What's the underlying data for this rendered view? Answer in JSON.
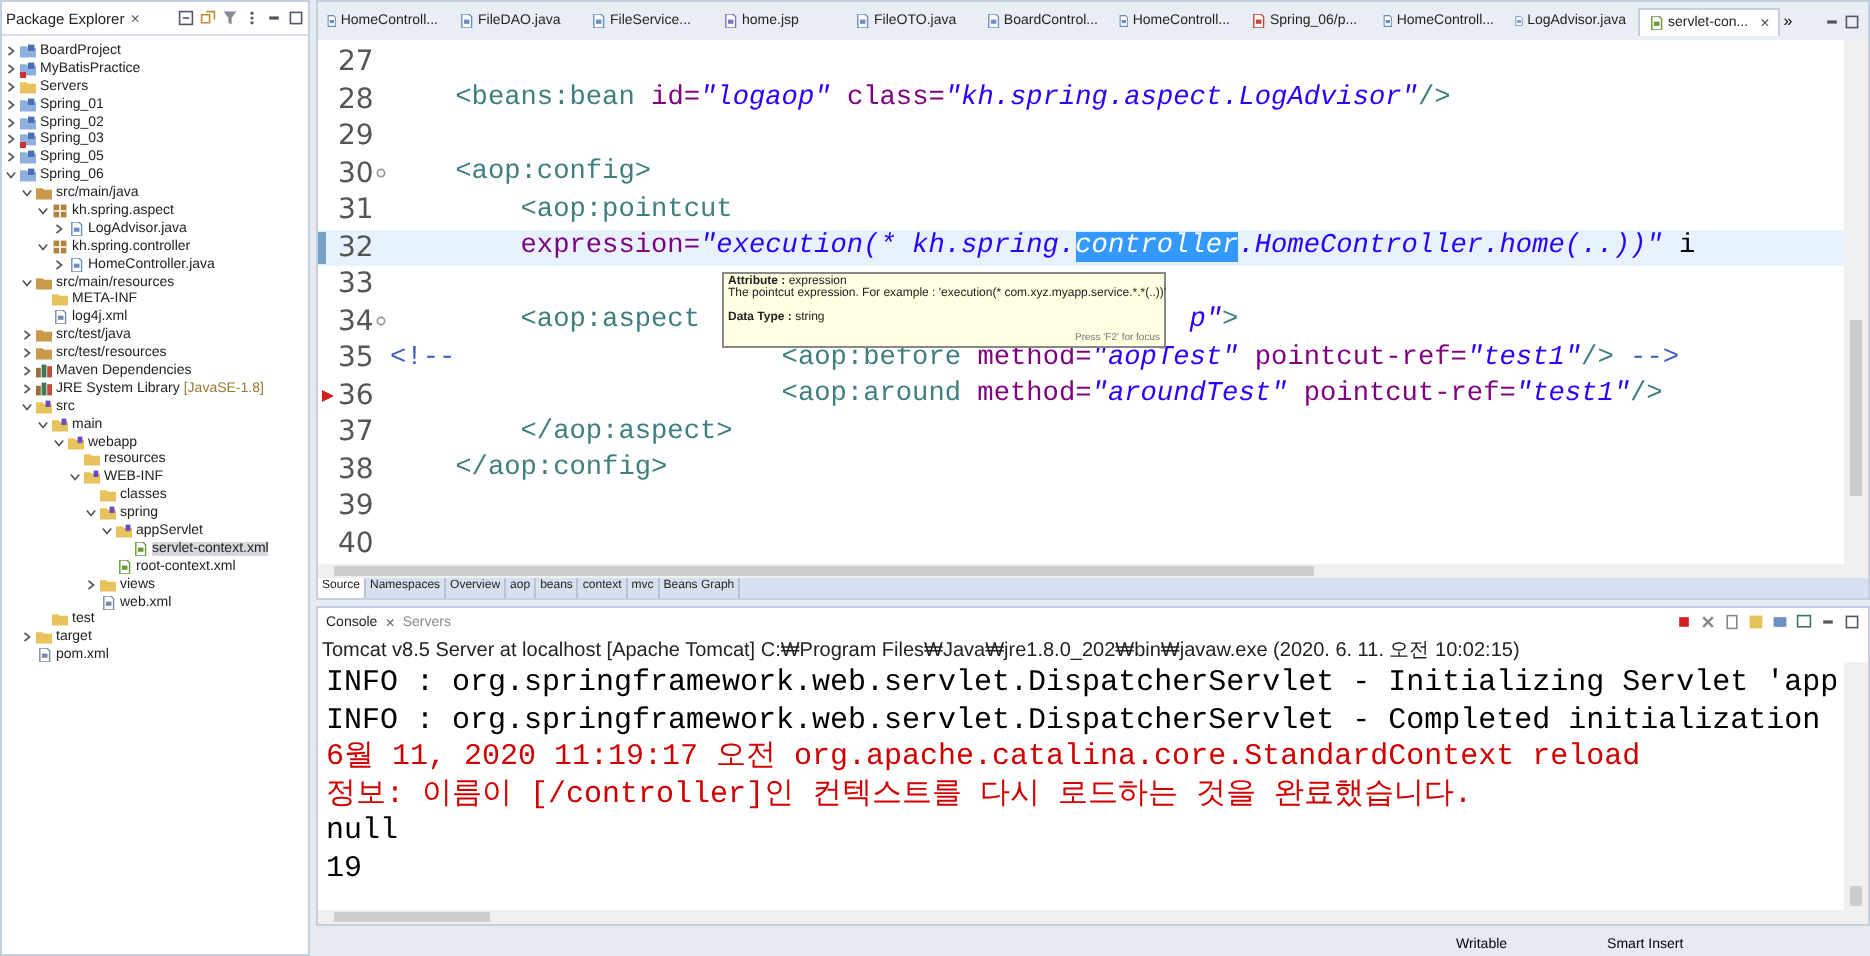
{
  "explorer": {
    "title": "Package Explorer",
    "close": "×",
    "tree": [
      {
        "label": "BoardProject",
        "kind": "project",
        "error": false,
        "expanded": false,
        "selected": false
      },
      {
        "label": "MyBatisPractice",
        "kind": "project",
        "error": true,
        "expanded": false,
        "selected": false
      },
      {
        "label": "Servers",
        "kind": "folder",
        "error": false,
        "expanded": false,
        "selected": false
      },
      {
        "label": "Spring_01",
        "kind": "project",
        "error": false,
        "expanded": false,
        "selected": false
      },
      {
        "label": "Spring_02",
        "kind": "project",
        "error": false,
        "expanded": false,
        "selected": false
      },
      {
        "label": "Spring_03",
        "kind": "project",
        "error": true,
        "expanded": false,
        "selected": false
      },
      {
        "label": "Spring_05",
        "kind": "project",
        "error": false,
        "expanded": false,
        "selected": false
      },
      {
        "label": "Spring_06",
        "kind": "project",
        "error": false,
        "expanded": true,
        "selected": false,
        "children": [
          {
            "label": "src/main/java",
            "kind": "source",
            "error": false,
            "expanded": true,
            "selected": false,
            "children": [
              {
                "label": "kh.spring.aspect",
                "kind": "package",
                "error": false,
                "expanded": true,
                "selected": false,
                "children": [
                  {
                    "label": "LogAdvisor.java",
                    "kind": "java",
                    "error": false,
                    "expanded": false,
                    "selected": false
                  }
                ]
              },
              {
                "label": "kh.spring.controller",
                "kind": "package",
                "error": false,
                "expanded": true,
                "selected": false,
                "children": [
                  {
                    "label": "HomeController.java",
                    "kind": "java",
                    "error": false,
                    "expanded": false,
                    "selected": false
                  }
                ]
              }
            ]
          },
          {
            "label": "src/main/resources",
            "kind": "source",
            "error": false,
            "expanded": true,
            "selected": false,
            "children": [
              {
                "label": "META-INF",
                "kind": "folder",
                "error": false,
                "selected": false
              },
              {
                "label": "log4j.xml",
                "kind": "xml",
                "error": false,
                "selected": false
              }
            ]
          },
          {
            "label": "src/test/java",
            "kind": "source",
            "error": false,
            "expanded": false,
            "selected": false
          },
          {
            "label": "src/test/resources",
            "kind": "source",
            "error": false,
            "expanded": false,
            "selected": false
          },
          {
            "label": "Maven Dependencies",
            "kind": "library",
            "error": false,
            "expanded": false,
            "selected": false
          },
          {
            "label": "JRE System Library",
            "decoration": "[JavaSE-1.8]",
            "kind": "library",
            "error": false,
            "expanded": false,
            "selected": false
          },
          {
            "label": "src",
            "kind": "spring",
            "error": false,
            "expanded": true,
            "selected": false,
            "children": [
              {
                "label": "main",
                "kind": "spring",
                "error": false,
                "expanded": true,
                "selected": false,
                "children": [
                  {
                    "label": "webapp",
                    "kind": "spring",
                    "error": false,
                    "expanded": true,
                    "selected": false,
                    "children": [
                      {
                        "label": "resources",
                        "kind": "folder",
                        "error": false,
                        "selected": false
                      },
                      {
                        "label": "WEB-INF",
                        "kind": "spring",
                        "error": false,
                        "expanded": true,
                        "selected": false,
                        "children": [
                          {
                            "label": "classes",
                            "kind": "folder",
                            "error": false,
                            "selected": false
                          },
                          {
                            "label": "spring",
                            "kind": "spring",
                            "error": false,
                            "expanded": true,
                            "selected": false,
                            "children": [
                              {
                                "label": "appServlet",
                                "kind": "spring",
                                "error": false,
                                "expanded": true,
                                "selected": false,
                                "children": [
                                  {
                                    "label": "servlet-context.xml",
                                    "kind": "beans",
                                    "error": false,
                                    "selected": true
                                  }
                                ]
                              },
                              {
                                "label": "root-context.xml",
                                "kind": "beans",
                                "error": false,
                                "selected": false
                              }
                            ]
                          },
                          {
                            "label": "views",
                            "kind": "folder",
                            "error": false,
                            "expanded": false,
                            "selected": false
                          },
                          {
                            "label": "web.xml",
                            "kind": "xml",
                            "error": false,
                            "selected": false
                          }
                        ]
                      }
                    ]
                  }
                ]
              },
              {
                "label": "test",
                "kind": "folder",
                "error": false,
                "selected": false
              }
            ]
          },
          {
            "label": "target",
            "kind": "folder",
            "error": false,
            "expanded": false,
            "selected": false
          },
          {
            "label": "pom.xml",
            "kind": "xml",
            "error": false,
            "selected": false
          }
        ]
      }
    ]
  },
  "editor": {
    "tabs": [
      {
        "label": "HomeControll...",
        "kind": "java",
        "selected": false
      },
      {
        "label": "FileDAO.java",
        "kind": "java",
        "selected": false
      },
      {
        "label": "FileService...",
        "kind": "java",
        "selected": false
      },
      {
        "label": "home.jsp",
        "kind": "jsp",
        "selected": false
      },
      {
        "label": "FileOTO.java",
        "kind": "java",
        "selected": false
      },
      {
        "label": "BoardControl...",
        "kind": "java",
        "selected": false
      },
      {
        "label": "HomeControll...",
        "kind": "java",
        "selected": false
      },
      {
        "label": "Spring_06/p...",
        "kind": "maven",
        "selected": false
      },
      {
        "label": "HomeControll...",
        "kind": "java",
        "selected": false
      },
      {
        "label": "LogAdvisor.java",
        "kind": "java",
        "selected": false
      },
      {
        "label": "servlet-con...",
        "kind": "beans",
        "selected": true
      }
    ],
    "tab_close": "×",
    "overflow": "»",
    "lines": [
      {
        "number": "27",
        "current": false,
        "foldable": false,
        "error_marker": false
      },
      {
        "number": "28",
        "current": false,
        "foldable": false,
        "error_marker": false,
        "tokens": [
          {
            "kind": "tag",
            "text": "    <beans:bean"
          },
          {
            "kind": "attr",
            "text": " id="
          },
          {
            "kind": "string",
            "text": "\"logaop\""
          },
          {
            "kind": "attr",
            "text": " class="
          },
          {
            "kind": "string",
            "text": "\"kh.spring.aspect.LogAdvisor\""
          },
          {
            "kind": "tag",
            "text": "/>"
          }
        ]
      },
      {
        "number": "29",
        "current": false,
        "foldable": false,
        "error_marker": false
      },
      {
        "number": "30",
        "current": false,
        "foldable": true,
        "error_marker": false,
        "tokens": [
          {
            "kind": "tag",
            "text": "    <aop:config>"
          }
        ]
      },
      {
        "number": "31",
        "current": false,
        "foldable": false,
        "error_marker": false,
        "tokens": [
          {
            "kind": "tag",
            "text": "        <aop:pointcut"
          }
        ]
      },
      {
        "number": "32",
        "current": true,
        "foldable": false,
        "error_marker": false,
        "tokens": [
          {
            "kind": "attr",
            "text": "        expression="
          },
          {
            "kind": "string",
            "text": "\"execution(* kh.spring."
          },
          {
            "kind": "selected",
            "text": "controller"
          },
          {
            "kind": "string",
            "text": ".HomeController.home(..))\""
          },
          {
            "kind": "plain",
            "text": " i"
          }
        ]
      },
      {
        "number": "33",
        "current": false,
        "foldable": false,
        "error_marker": false
      },
      {
        "number": "34",
        "current": false,
        "foldable": true,
        "error_marker": false,
        "tokens": [
          {
            "kind": "tag",
            "text": "        <aop:aspect"
          },
          {
            "kind": "string",
            "text": "p\"",
            "after_covered_gap": true
          },
          {
            "kind": "tag",
            "text": ">"
          }
        ]
      },
      {
        "number": "35",
        "current": false,
        "foldable": false,
        "error_marker": false,
        "tokens": [
          {
            "kind": "comment",
            "text": "<!--"
          },
          {
            "kind": "tag",
            "text": "                    <aop:before"
          },
          {
            "kind": "attr",
            "text": " method="
          },
          {
            "kind": "string",
            "text": "\"aopTest\""
          },
          {
            "kind": "attr",
            "text": " pointcut-ref="
          },
          {
            "kind": "string",
            "text": "\"test1\""
          },
          {
            "kind": "tag",
            "text": "/>"
          },
          {
            "kind": "comment",
            "text": " -->"
          }
        ]
      },
      {
        "number": "36",
        "current": false,
        "foldable": false,
        "error_marker": true,
        "tokens": [
          {
            "kind": "tag",
            "text": "                        <aop:around"
          },
          {
            "kind": "attr",
            "text": " method="
          },
          {
            "kind": "string",
            "text": "\"aroundTest\""
          },
          {
            "kind": "attr",
            "text": " pointcut-ref="
          },
          {
            "kind": "string",
            "text": "\"test1\""
          },
          {
            "kind": "tag",
            "text": "/>"
          }
        ]
      },
      {
        "number": "37",
        "current": false,
        "foldable": false,
        "error_marker": false,
        "tokens": [
          {
            "kind": "tag",
            "text": "        </aop:aspect>"
          }
        ]
      },
      {
        "number": "38",
        "current": false,
        "foldable": false,
        "error_marker": false,
        "tokens": [
          {
            "kind": "tag",
            "text": "    </aop:config>"
          }
        ]
      },
      {
        "number": "39",
        "current": false,
        "foldable": false,
        "error_marker": false
      },
      {
        "number": "40",
        "current": false,
        "foldable": false,
        "error_marker": false
      }
    ],
    "tooltip": {
      "heading": "**Attribute :** expression",
      "description": "The pointcut expression. For example : 'execution(* com.xyz.myapp.service.*.*(..))'",
      "type": "**Data Type :** string",
      "hint": "Press 'F2' for focus"
    },
    "bottom_tabs": [
      {
        "label": "Source",
        "selected": true
      },
      {
        "label": "Namespaces",
        "selected": false
      },
      {
        "label": "Overview",
        "selected": false
      },
      {
        "label": "aop",
        "selected": false
      },
      {
        "label": "beans",
        "selected": false
      },
      {
        "label": "context",
        "selected": false
      },
      {
        "label": "mvc",
        "selected": false
      },
      {
        "label": "Beans Graph",
        "selected": false
      }
    ]
  },
  "console": {
    "tabs": [
      {
        "label": "Console",
        "selected": true
      },
      {
        "label": "Servers",
        "selected": false
      }
    ],
    "close": "×",
    "launch": "Tomcat v8.5 Server at localhost [Apache Tomcat] C:₩Program Files₩Java₩jre1.8.0_202₩bin₩javaw.exe (2020. 6. 11. 오전 10:02:15)",
    "output": [
      {
        "kind": "stdout",
        "text": "INFO : org.springframework.web.servlet.DispatcherServlet - Initializing Servlet 'app"
      },
      {
        "kind": "stdout",
        "text": "INFO : org.springframework.web.servlet.DispatcherServlet - Completed initialization"
      },
      {
        "kind": "stderr",
        "text": "6월 11, 2020 11:19:17 오전 org.apache.catalina.core.StandardContext reload"
      },
      {
        "kind": "stderr",
        "text": "정보: 이름이 [/controller]인 컨텍스트를 다시 로드하는 것을 완료했습니다."
      },
      {
        "kind": "stdout",
        "text": "null"
      },
      {
        "kind": "stdout",
        "text": "19"
      }
    ]
  },
  "status_bar": {
    "items": [
      "Writable",
      "Smart Insert"
    ]
  }
}
